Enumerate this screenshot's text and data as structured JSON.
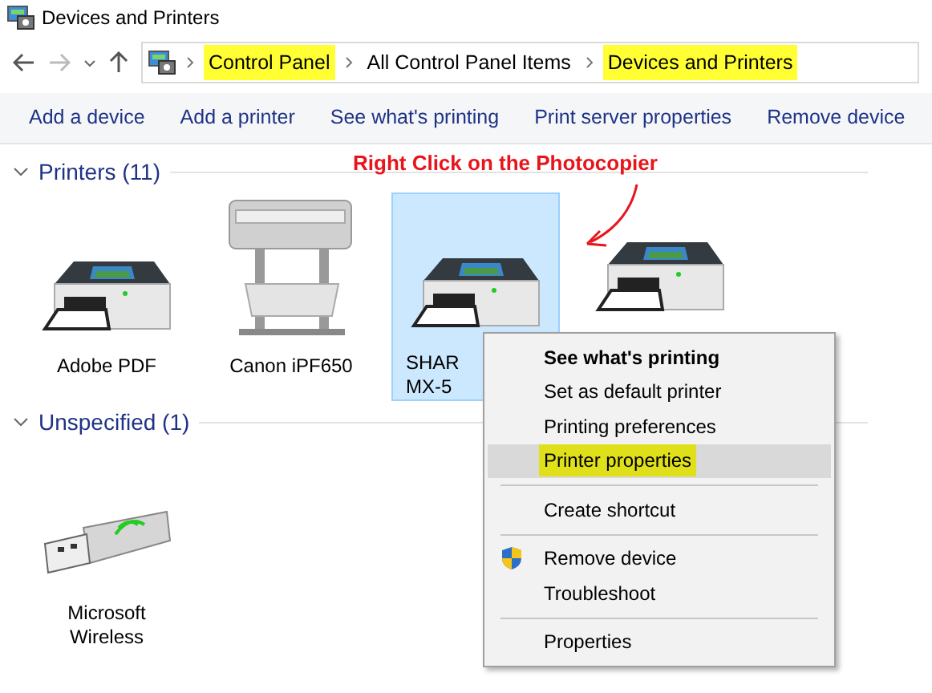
{
  "window": {
    "title": "Devices and Printers"
  },
  "nav": {
    "back_disabled": false,
    "forward_disabled": true
  },
  "breadcrumb": [
    {
      "label": "Control Panel",
      "highlighted": true
    },
    {
      "label": "All Control Panel Items",
      "highlighted": false
    },
    {
      "label": "Devices and Printers",
      "highlighted": true
    }
  ],
  "toolbar": [
    "Add a device",
    "Add a printer",
    "See what's printing",
    "Print server properties",
    "Remove device"
  ],
  "annotation": "Right Click on the Photocopier",
  "groups": [
    {
      "title": "Printers (11)",
      "devices": [
        {
          "kind": "printer",
          "lines": [
            "Adobe PDF"
          ],
          "selected": false
        },
        {
          "kind": "plotter",
          "lines": [
            "Canon iPF650"
          ],
          "selected": false
        },
        {
          "kind": "printer",
          "lines": [
            "SHAR",
            "MX-5"
          ],
          "selected": true
        },
        {
          "kind": "printer",
          "selected": false
        }
      ]
    },
    {
      "title": "Unspecified (1)",
      "devices": [
        {
          "kind": "usb",
          "lines": [
            "Microsoft",
            "Wireless"
          ],
          "selected": false
        }
      ]
    }
  ],
  "context_menu": [
    {
      "kind": "item",
      "label": "See what's printing",
      "bold": true,
      "hovered": false,
      "highlighted": false
    },
    {
      "kind": "item",
      "label": "Set as default printer",
      "bold": false,
      "hovered": false,
      "highlighted": false
    },
    {
      "kind": "item",
      "label": "Printing preferences",
      "bold": false,
      "hovered": false,
      "highlighted": false
    },
    {
      "kind": "item",
      "label": "Printer properties",
      "bold": false,
      "hovered": true,
      "highlighted": true
    },
    {
      "kind": "separator"
    },
    {
      "kind": "item",
      "label": "Create shortcut",
      "bold": false,
      "hovered": false,
      "highlighted": false
    },
    {
      "kind": "separator"
    },
    {
      "kind": "admin-item",
      "label": "Remove device",
      "bold": false,
      "hovered": false,
      "highlighted": false
    },
    {
      "kind": "item",
      "label": "Troubleshoot",
      "bold": false,
      "hovered": false,
      "highlighted": false
    },
    {
      "kind": "separator"
    },
    {
      "kind": "item",
      "label": "Properties",
      "bold": false,
      "hovered": false,
      "highlighted": false
    }
  ]
}
